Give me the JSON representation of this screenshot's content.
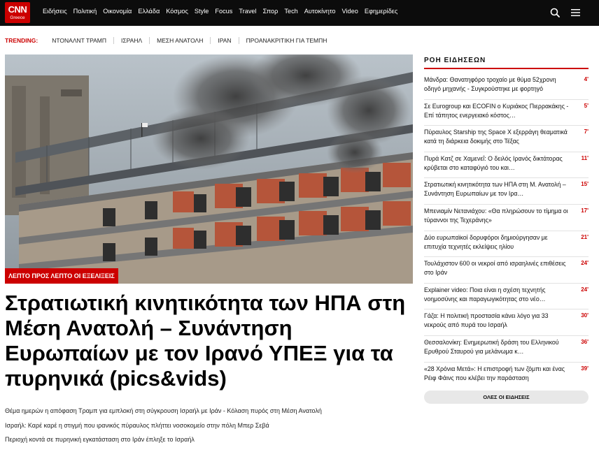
{
  "header": {
    "logo_main": "CNN",
    "logo_sub": "Greece",
    "nav": [
      "Ειδήσεις",
      "Πολιτική",
      "Οικονομία",
      "Ελλάδα",
      "Κόσμος",
      "Style",
      "Focus",
      "Travel",
      "Σπορ",
      "Tech",
      "Αυτοκίνητο",
      "Video",
      "Εφημερίδες"
    ],
    "icons": {
      "search": "search-icon",
      "menu": "hamburger-menu-icon"
    }
  },
  "trending": {
    "label": "TRENDING:",
    "items": [
      "ΝΤΟΝΑΛΝΤ ΤΡΑΜΠ",
      "ΙΣΡΑΗΛ",
      "ΜΕΣΗ ΑΝΑΤΟΛΗ",
      "ΙΡΑΝ",
      "ΠΡΟΑΝΑΚΡΙΤΙΚΗ ΓΙΑ ΤΕΜΠΗ"
    ]
  },
  "hero": {
    "badge": "ΛΕΠΤΟ ΠΡΟΣ ΛΕΠΤΟ ΟΙ ΕΞΕΛΙΞΕΙΣ",
    "headline": "Στρατιωτική κινητικότητα των ΗΠΑ στη Μέση Ανατολή – Συνάντηση Ευρωπαίων με τον Ιρανό ΥΠΕΞ για τα πυρηνικά (pics&vids)",
    "related": [
      "Θέμα ημερών η απόφαση Τραμπ για εμπλοκή στη σύγκρουση Ισραήλ με Ιράν - Κόλαση πυρός στη Μέση Ανατολή",
      "Ισραήλ: Καρέ καρέ η στιγμή που ιρανικός πύραυλος πλήττει νοσοκομείο στην πόλη Μπερ Σεβά",
      "Περιοχή κοντά σε πυρηνική εγκατάσταση στο Ιράν έπληξε το Ισραήλ"
    ]
  },
  "feed": {
    "title": "ΡΟΗ ΕΙΔΗΣΕΩΝ",
    "items": [
      {
        "text": "Μάνδρα: Θανατηφόρο τροχαίο με θύμα 52χρονη οδηγό μηχανής - Συγκρούστηκε με φορτηγό",
        "time": "4'"
      },
      {
        "text": "Σε Eurogroup και ECOFIN ο Κυριάκος Πιερρακάκης - Επί τάπητος ενεργειακό κόστος…",
        "time": "5'"
      },
      {
        "text": "Πύραυλος Starship της Space X εξερράγη θεαματικά κατά τη διάρκεια δοκιμής στο Τέξας",
        "time": "7'"
      },
      {
        "text": "Πυρά Κατζ σε Χαμενεΐ: Ο δειλός Ιρανός δικτάτορας κρύβεται στο καταφύγιό του και…",
        "time": "11'"
      },
      {
        "text": "Στρατιωτική κινητικότητα των ΗΠΑ στη Μ. Ανατολή – Συνάντηση Ευρωπαίων με τον Ιρα…",
        "time": "15'"
      },
      {
        "text": "Μπενιαμίν Νετανιάχου: «Θα πληρώσουν το τίμημα οι τύραννοι της Τεχεράνης»",
        "time": "17'"
      },
      {
        "text": "Δύο ευρωπαϊκοί δορυφόροι δημιούργησαν με επιτυχία τεχνητές εκλείψεις ηλίου",
        "time": "21'"
      },
      {
        "text": "Τουλάχιστον 600 οι νεκροί από ισραηλινές επιθέσεις στο Ιράν",
        "time": "24'"
      },
      {
        "text": "Explainer video: Ποια είναι η σχέση τεχνητής νοημοσύνης και παραγωγικότητας στο νέο…",
        "time": "24'"
      },
      {
        "text": "Γάζα: Η πολιτική προστασία κάνει λόγο για 33 νεκρούς από πυρά του Ισραήλ",
        "time": "30'"
      },
      {
        "text": "Θεσσαλονίκη: Ενημερωτική δράση του Ελληνικού Ερυθρού Σταυρού για μελάνωμα κ…",
        "time": "36'"
      },
      {
        "text": "«28 Χρόνια Μετά»: Η επιστροφή των ζόμπι και ένας Ρέιφ Φάινς που κλέβει την παράσταση",
        "time": "39'"
      }
    ],
    "all_label": "ΟΛΕΣ ΟΙ ΕΙΔΗΣΕΙΣ"
  },
  "colors": {
    "brand_red": "#cc0000",
    "topbar": "#0c0c0c"
  }
}
